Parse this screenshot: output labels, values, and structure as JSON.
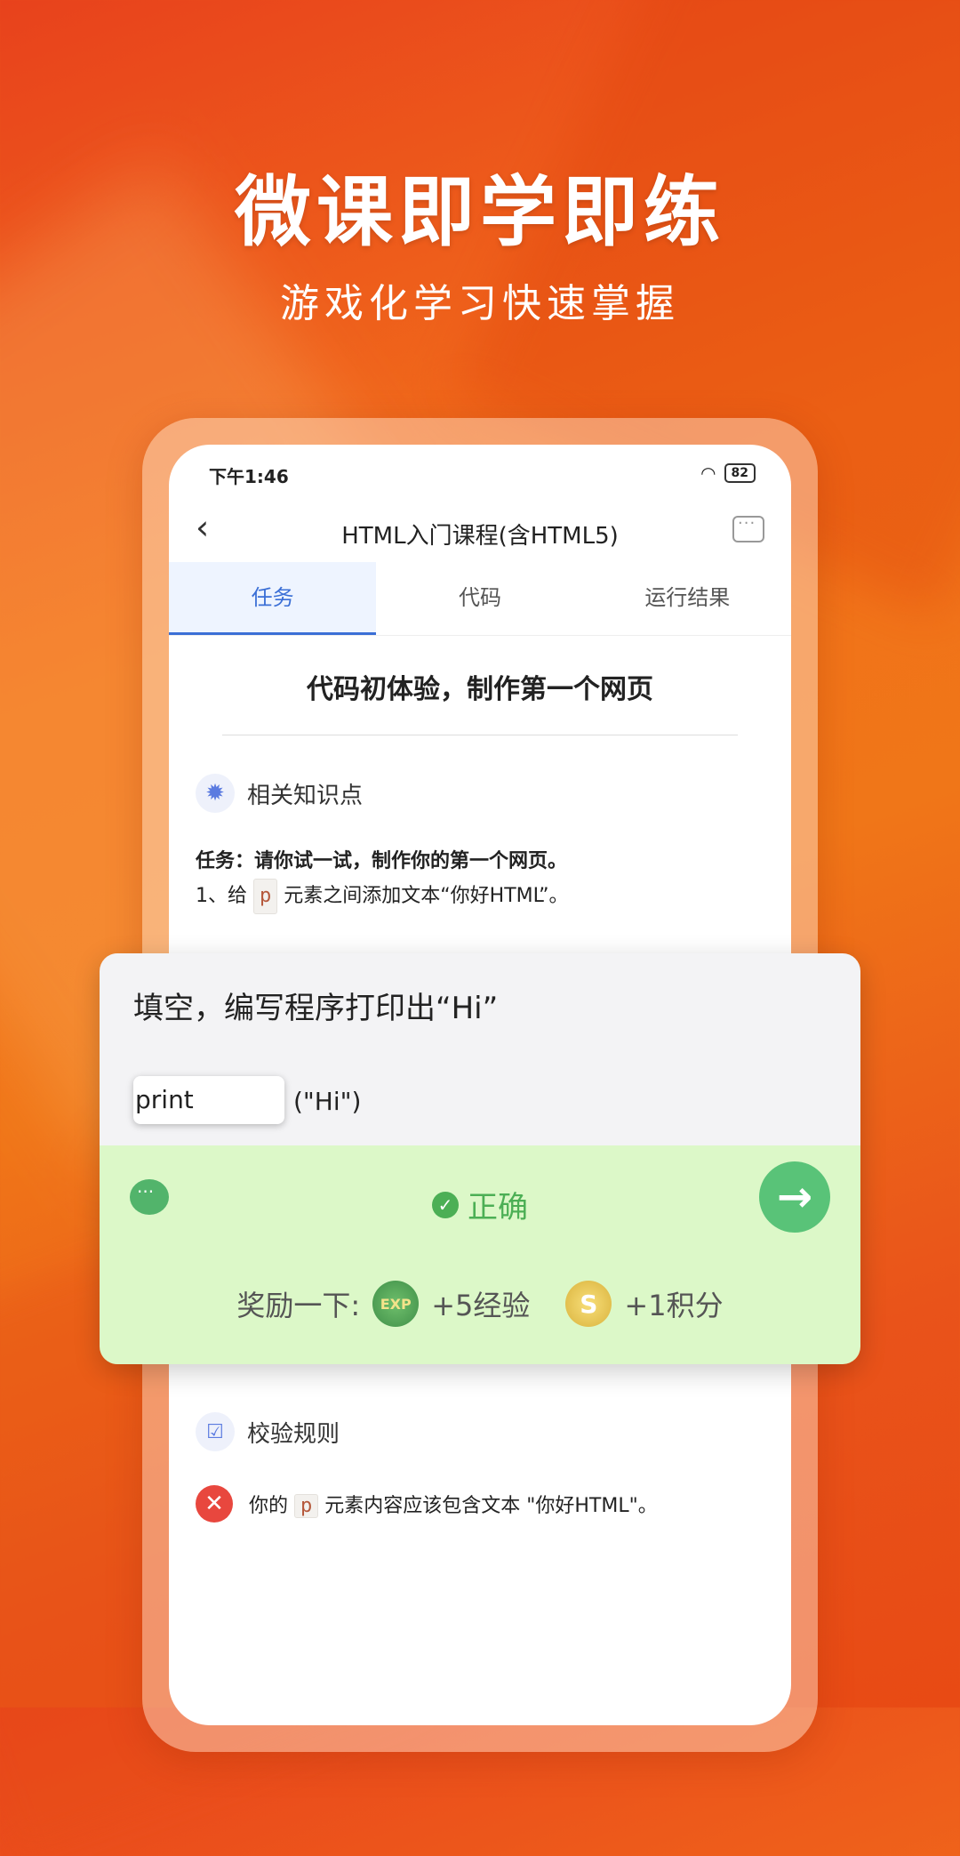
{
  "hero": {
    "title": "微课即学即练",
    "subtitle": "游戏化学习快速掌握"
  },
  "status_bar": {
    "time": "下午1:46",
    "battery": "82"
  },
  "nav": {
    "back_icon": "chevron-left",
    "title": "HTML入门课程(含HTML5)",
    "chat_icon": "chat-bubble"
  },
  "tabs": [
    {
      "label": "任务",
      "active": true
    },
    {
      "label": "代码",
      "active": false
    },
    {
      "label": "运行结果",
      "active": false
    }
  ],
  "task": {
    "heading": "代码初体验，制作第一个网页",
    "knowledge_label": "相关知识点",
    "line1": "任务：请你试一试，制作你的第一个网页。",
    "line2_prefix": "1、给",
    "line2_tag": "p",
    "line2_suffix": "元素之间添加文本“你好HTML”。"
  },
  "quiz": {
    "prompt": "填空，编写程序打印出“Hi”",
    "input_value": "print",
    "code_suffix": "(\"Hi\")",
    "result": "正确",
    "reward_label": "奖励一下:",
    "exp_badge": "EXP",
    "exp_text": "+5经验",
    "coin_badge": "S",
    "points_text": "+1积分"
  },
  "rules": {
    "label": "校验规则",
    "error_prefix": "你的",
    "error_tag": "p",
    "error_suffix": "元素内容应该包含文本 \"你好HTML\"。"
  },
  "colors": {
    "accent_blue": "#3b6fd6",
    "success_green": "#4caf55",
    "error_red": "#e8473e",
    "bg_orange": "#f2711a"
  }
}
